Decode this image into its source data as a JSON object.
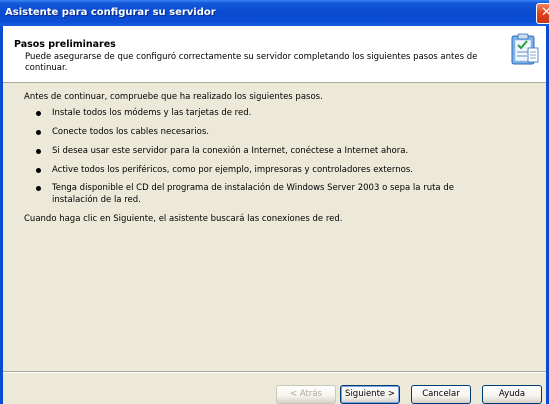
{
  "window": {
    "title": "Asistente para configurar su servidor",
    "close_glyph": "✕"
  },
  "header": {
    "title": "Pasos preliminares",
    "subtitle": "Puede asegurarse de que configuró correctamente su servidor completando los siguientes pasos antes de continuar.",
    "icon": "wizard-clipboard-icon"
  },
  "content": {
    "intro": "Antes de continuar, compruebe que ha realizado los siguientes pasos.",
    "steps": [
      "Instale todos los módems y las tarjetas de red.",
      "Conecte todos los cables necesarios.",
      "Si desea usar este servidor para la conexión a Internet, conéctese a Internet ahora.",
      "Active todos los periféricos, como por ejemplo, impresoras y controladores externos.",
      "Tenga disponible el CD del programa de instalación de Windows Server 2003 o sepa la ruta de",
      "instalación de la red."
    ],
    "outro": "Cuando haga clic en Siguiente, el asistente buscará las conexiones de red."
  },
  "buttons": {
    "back": "< Atrás",
    "next": "Siguiente >",
    "cancel": "Cancelar",
    "help": "Ayuda"
  },
  "colors": {
    "titlebar": "#0a4bd0",
    "dialog_bg": "#ece9d8",
    "close": "#e0451f"
  }
}
